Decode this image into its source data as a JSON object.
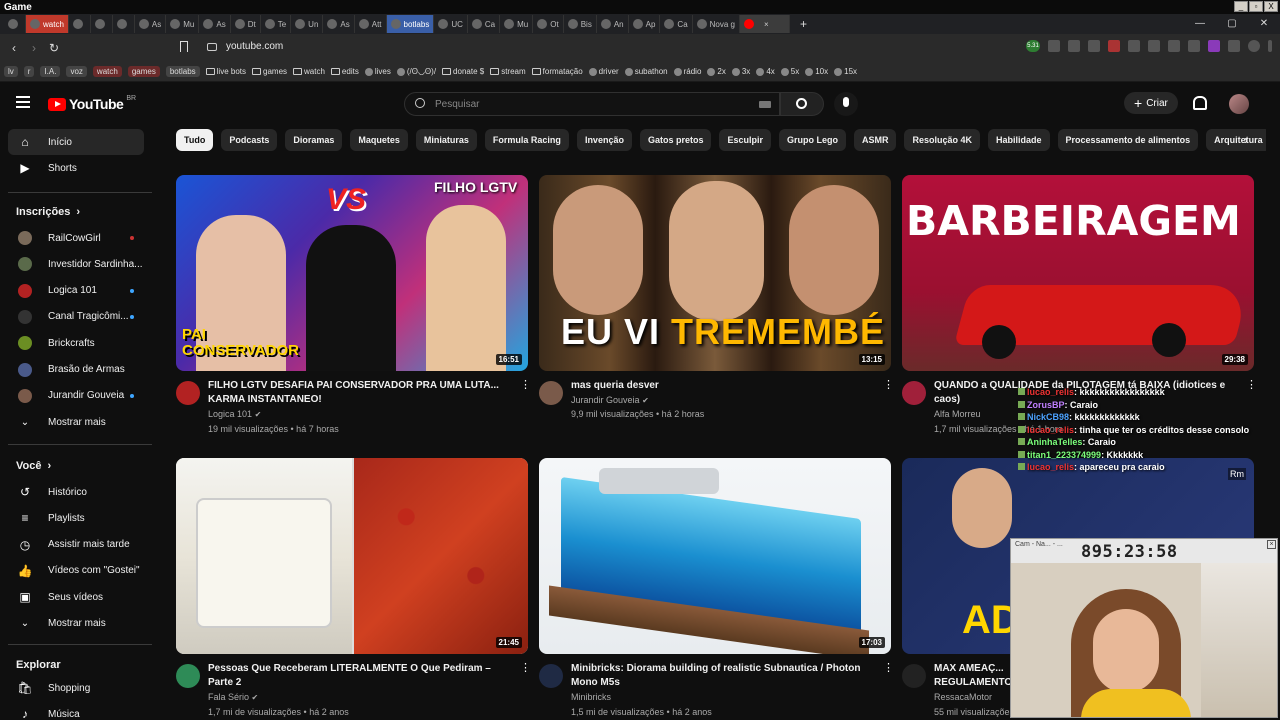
{
  "os": {
    "title": "Game",
    "controls": [
      "_",
      "▫",
      "X"
    ]
  },
  "tabs": [
    {
      "label": "",
      "style": "plain"
    },
    {
      "label": "watch",
      "style": "red"
    },
    {
      "label": "",
      "style": "plain"
    },
    {
      "label": "",
      "style": "plain"
    },
    {
      "label": "",
      "style": "plain"
    },
    {
      "label": "As",
      "style": "plain"
    },
    {
      "label": "Mu",
      "style": "plain"
    },
    {
      "label": "As",
      "style": "plain"
    },
    {
      "label": "Dt",
      "style": "plain"
    },
    {
      "label": "Te",
      "style": "plain"
    },
    {
      "label": "Un",
      "style": "plain"
    },
    {
      "label": "As",
      "style": "plain"
    },
    {
      "label": "Att",
      "style": "plain"
    },
    {
      "label": "botlabs",
      "style": "blue"
    },
    {
      "label": "UC",
      "style": "plain"
    },
    {
      "label": "Ca",
      "style": "plain"
    },
    {
      "label": "Mu",
      "style": "plain"
    },
    {
      "label": "Ot",
      "style": "plain"
    },
    {
      "label": "Bis",
      "style": "plain"
    },
    {
      "label": "An",
      "style": "plain"
    },
    {
      "label": "Ap",
      "style": "plain"
    },
    {
      "label": "Ca",
      "style": "plain"
    },
    {
      "label": "Nova g",
      "style": "plain"
    },
    {
      "label": "",
      "style": "active"
    }
  ],
  "window_controls": [
    "—",
    "▢",
    "✕"
  ],
  "address": {
    "url": "youtube.com",
    "badge": "5.31"
  },
  "bookmarks": [
    {
      "label": "lv",
      "type": "pill"
    },
    {
      "label": "r",
      "type": "pill"
    },
    {
      "label": "I.A.",
      "type": "pill"
    },
    {
      "label": "voz",
      "type": "pill"
    },
    {
      "label": "watch",
      "type": "pill-red"
    },
    {
      "label": "games",
      "type": "pill-red"
    },
    {
      "label": "botlabs",
      "type": "pill"
    },
    {
      "label": "live bots",
      "type": "folder"
    },
    {
      "label": "games",
      "type": "folder"
    },
    {
      "label": "watch",
      "type": "folder"
    },
    {
      "label": "edits",
      "type": "folder"
    },
    {
      "label": "lives",
      "type": "icon"
    },
    {
      "label": "(/ʘ◡ʘ)/",
      "type": "icon"
    },
    {
      "label": "donate $",
      "type": "folder"
    },
    {
      "label": "stream",
      "type": "folder"
    },
    {
      "label": "formatação",
      "type": "folder"
    },
    {
      "label": "driver",
      "type": "icon"
    },
    {
      "label": "subathon",
      "type": "icon"
    },
    {
      "label": "rádio",
      "type": "icon"
    },
    {
      "label": "2x",
      "type": "icon"
    },
    {
      "label": "3x",
      "type": "icon"
    },
    {
      "label": "4x",
      "type": "icon"
    },
    {
      "label": "5x",
      "type": "icon"
    },
    {
      "label": "10x",
      "type": "icon"
    },
    {
      "label": "15x",
      "type": "icon"
    }
  ],
  "yt": {
    "logo": "YouTube",
    "country": "BR",
    "search_placeholder": "Pesquisar",
    "create_label": "Criar"
  },
  "sidebar": {
    "main": [
      {
        "label": "Início",
        "icon": "home-icon",
        "active": true
      },
      {
        "label": "Shorts",
        "icon": "shorts-icon",
        "active": false
      }
    ],
    "subs_heading": "Inscrições",
    "subs": [
      {
        "label": "RailCowGirl",
        "color": "#7a6a5a",
        "marker": "live"
      },
      {
        "label": "Investidor Sardinha...",
        "color": "#5a6a4a",
        "marker": ""
      },
      {
        "label": "Logica 101",
        "color": "#b22222",
        "marker": "dot"
      },
      {
        "label": "Canal Tragicômi...",
        "color": "#333333",
        "marker": "dot"
      },
      {
        "label": "Brickcrafts",
        "color": "#6b8e23",
        "marker": ""
      },
      {
        "label": "Brasão de Armas",
        "color": "#4a5a8a",
        "marker": ""
      },
      {
        "label": "Jurandir Gouveia",
        "color": "#7a5a4a",
        "marker": "dot"
      }
    ],
    "subs_more": "Mostrar mais",
    "you_heading": "Você",
    "you": [
      {
        "label": "Histórico",
        "icon": "history-icon"
      },
      {
        "label": "Playlists",
        "icon": "playlists-icon"
      },
      {
        "label": "Assistir mais tarde",
        "icon": "watch-later-icon"
      },
      {
        "label": "Vídeos com \"Gostei\"",
        "icon": "like-icon"
      },
      {
        "label": "Seus vídeos",
        "icon": "your-videos-icon"
      }
    ],
    "you_more": "Mostrar mais",
    "explore_heading": "Explorar",
    "explore": [
      {
        "label": "Shopping",
        "icon": "shopping-icon"
      },
      {
        "label": "Música",
        "icon": "music-icon"
      }
    ]
  },
  "chips": [
    "Tudo",
    "Podcasts",
    "Dioramas",
    "Maquetes",
    "Miniaturas",
    "Formula Racing",
    "Invenção",
    "Gatos pretos",
    "Esculpir",
    "Grupo Lego",
    "ASMR",
    "Resolução 4K",
    "Habilidade",
    "Processamento de alimentos",
    "Arquitetura"
  ],
  "videos": [
    {
      "title": "FILHO LGTV DESAFIA PAI CONSERVADOR PRA UMA LUTA... KARMA INSTANTANEO!",
      "channel": "Logica 101",
      "verified": true,
      "meta": "19 mil visualizações • há 7 horas",
      "duration": "16:51",
      "thumb_text_1": "VS",
      "thumb_text_2": "FILHO LGTV",
      "thumb_text_3": "PAI CONSERVADOR",
      "avatar_color": "#b22222"
    },
    {
      "title": "mas queria desver",
      "channel": "Jurandir Gouveia",
      "verified": true,
      "meta": "9,9 mil visualizações • há 2 horas",
      "duration": "13:15",
      "thumb_text_1": "EU VI",
      "thumb_text_2": "TREMEMBÉ",
      "avatar_color": "#7a5a4a"
    },
    {
      "title": "QUANDO a QUALIDADE da PILOTAGEM tá BAIXA (idiotices e caos)",
      "channel": "Alfa Morreu",
      "verified": false,
      "meta": "1,7 mil visualizações • há 1 hora",
      "duration": "29:38",
      "thumb_text_1": "BARBEIRAGEM",
      "avatar_color": "#a0203a"
    },
    {
      "title": "Pessoas Que Receberam LITERALMENTE O Que Pediram – Parte 2",
      "channel": "Fala Sério",
      "verified": true,
      "meta": "1,7 mi de visualizações • há 2 anos",
      "duration": "21:45",
      "avatar_color": "#2e8b57"
    },
    {
      "title": "Minibricks: Diorama building of realistic Subnautica / Photon Mono M5s",
      "channel": "Minibricks",
      "verified": false,
      "meta": "1,5 mi de visualizações • há 2 anos",
      "duration": "17:03",
      "avatar_color": "#1f2a44"
    },
    {
      "title": "MAX AMEAÇ... REGULAMENTO...",
      "channel": "RessacaMotor",
      "verified": false,
      "meta": "55 mil visualizações",
      "duration": "",
      "thumb_text_1": "ADE",
      "avatar_color": "#222222"
    }
  ],
  "stream_chat": [
    {
      "name": "lucao_relis",
      "text": ": kkkkkkkkkkkkkkkkk",
      "cls": "n2"
    },
    {
      "name": "ZorusBP",
      "text": ": Caraio",
      "cls": "n4"
    },
    {
      "name": "NickCB98",
      "text": ": kkkkkkkkkkkkk",
      "cls": "n"
    },
    {
      "name": "lucao_relis",
      "text": ": tinha que ter os créditos desse consolo",
      "cls": "n2"
    },
    {
      "name": "AninhaTelles",
      "text": ": Caraio",
      "cls": "n3"
    },
    {
      "name": "titan1_223374999",
      "text": ": Kkkkkkk",
      "cls": "n3"
    },
    {
      "name": "lucao_relis",
      "text": ": apareceu pra caraio",
      "cls": "n2"
    }
  ],
  "webcam": {
    "timer": "895:23:58",
    "small_title": "Cam - Na... - ...",
    "badge": "Rm"
  }
}
